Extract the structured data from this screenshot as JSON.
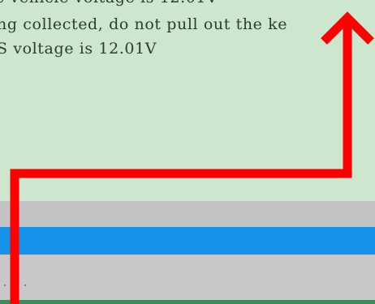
{
  "console": {
    "lines": [
      "e vehicle voltage is 12.01V",
      "ng collected, do not pull out the ke",
      "S voltage is 12.01V"
    ]
  },
  "list": {
    "partial_text": ". ."
  },
  "colors": {
    "console_bg": "#cde6ce",
    "selected_row": "#1592ea",
    "annotation_arrow": "#ff0000"
  },
  "icons": {
    "annotation": "up-arrow-annotation"
  }
}
